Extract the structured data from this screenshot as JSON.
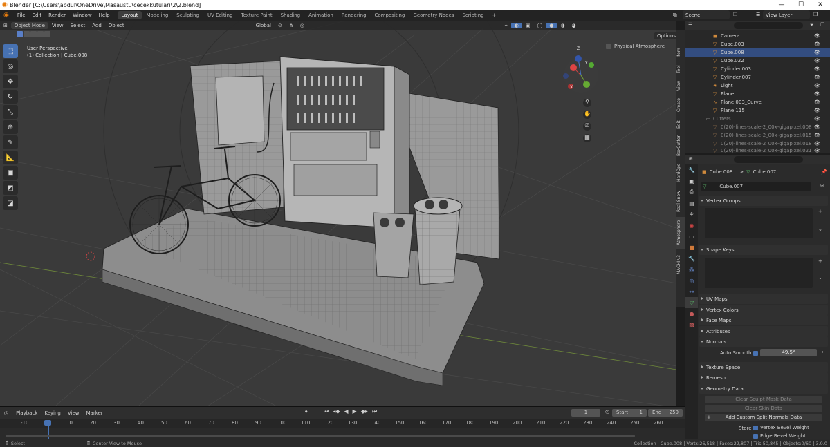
{
  "window": {
    "title": "Blender [C:\\Users\\abdul\\OneDrive\\Masaüstü\\cecekkutulari\\2\\2.blend]",
    "controls": [
      "—",
      "☐",
      "✕"
    ]
  },
  "topbar": {
    "menus": [
      "File",
      "Edit",
      "Render",
      "Window",
      "Help"
    ],
    "workspaces": [
      "Layout",
      "Modeling",
      "Sculpting",
      "UV Editing",
      "Texture Paint",
      "Shading",
      "Animation",
      "Rendering",
      "Compositing",
      "Geometry Nodes",
      "Scripting"
    ],
    "active_workspace": "Layout",
    "add_workspace": "+",
    "scene": "Scene",
    "view_layer": "View Layer"
  },
  "viewport": {
    "mode": "Object Mode",
    "menus": [
      "View",
      "Select",
      "Add",
      "Object"
    ],
    "transform_orientation": "Global",
    "options_label": "Options",
    "perspective_label": "User Perspective",
    "collection_label": "(1) Collection | Cube.008",
    "physical_atmosphere": "Physical Atmosphere",
    "gizmo_axes": [
      "X",
      "Y",
      "Z"
    ]
  },
  "side_tabs": [
    "Item",
    "Tool",
    "View",
    "Create",
    "Edit",
    "BoxCutter",
    "HardOps",
    "Real Snow",
    "Atmosphere",
    "MACHIN3"
  ],
  "outliner": {
    "rows": [
      {
        "name": "Camera",
        "selected": false,
        "dim": false
      },
      {
        "name": "Cube.003",
        "selected": false,
        "dim": false
      },
      {
        "name": "Cube.008",
        "selected": true,
        "dim": false
      },
      {
        "name": "Cube.022",
        "selected": false,
        "dim": false
      },
      {
        "name": "Cylinder.003",
        "selected": false,
        "dim": false
      },
      {
        "name": "Cylinder.007",
        "selected": false,
        "dim": false
      },
      {
        "name": "Light",
        "selected": false,
        "dim": false
      },
      {
        "name": "Plane",
        "selected": false,
        "dim": false
      },
      {
        "name": "Plane.003_Curve",
        "selected": false,
        "dim": false
      },
      {
        "name": "Plane.115",
        "selected": false,
        "dim": false
      },
      {
        "name": "Cutters",
        "selected": false,
        "dim": true
      },
      {
        "name": "0(20)-lines-scale-2_00x-gigapixel.008",
        "selected": false,
        "dim": true
      },
      {
        "name": "0(20)-lines-scale-2_00x-gigapixel.015",
        "selected": false,
        "dim": true
      },
      {
        "name": "0(20)-lines-scale-2_00x-gigapixel.018",
        "selected": false,
        "dim": true
      },
      {
        "name": "0(20)-lines-scale-2_00x-gigapixel.021",
        "selected": false,
        "dim": true
      }
    ]
  },
  "properties": {
    "breadcrumb_object": "Cube.008",
    "breadcrumb_sep": ">",
    "breadcrumb_mesh": "Cube.007",
    "mesh_name": "Cube.007",
    "sections": {
      "vertex_groups": "Vertex Groups",
      "shape_keys": "Shape Keys",
      "uv_maps": "UV Maps",
      "vertex_colors": "Vertex Colors",
      "face_maps": "Face Maps",
      "attributes": "Attributes",
      "normals": "Normals",
      "texture_space": "Texture Space",
      "remesh": "Remesh",
      "geometry_data": "Geometry Data"
    },
    "auto_smooth_label": "Auto Smooth",
    "auto_smooth_angle": "49.5°",
    "clear_sculpt_mask": "Clear Sculpt Mask Data",
    "clear_skin": "Clear Skin Data",
    "add_split_normals": "Add Custom Split Normals Data",
    "store_label": "Store",
    "vertex_bevel": "Vertex Bevel Weight",
    "edge_bevel": "Edge Bevel Weight"
  },
  "timeline": {
    "menus": [
      "Playback",
      "Keying",
      "View",
      "Marker"
    ],
    "current_frame": "1",
    "start_label": "Start",
    "start": "1",
    "end_label": "End",
    "end": "250",
    "ruler": [
      "-10",
      "1",
      "10",
      "20",
      "30",
      "40",
      "50",
      "60",
      "70",
      "80",
      "90",
      "100",
      "110",
      "120",
      "130",
      "140",
      "150",
      "160",
      "170",
      "180",
      "190",
      "200",
      "210",
      "220",
      "230",
      "240",
      "250",
      "260"
    ]
  },
  "status": {
    "select": "Select",
    "center": "Center View to Mouse",
    "info": "Collection | Cube.008 | Verts:26,518 | Faces:22,807 | Tris:50,845 | Objects:0/60 | 3.0.0"
  },
  "colors": {
    "accent": "#4772b3",
    "selection": "#334d80",
    "mesh_icon": "#5bbf6a"
  }
}
